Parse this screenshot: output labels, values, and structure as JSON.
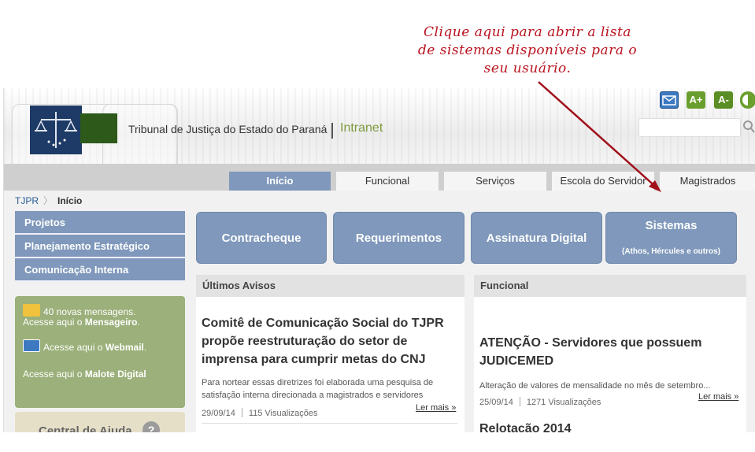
{
  "annotation": {
    "lines": [
      "Clique aqui para abrir a lista",
      "de sistemas disponíveis para o",
      "seu usuário."
    ],
    "color": "#b8121e"
  },
  "header": {
    "site_title": "Tribunal de Justiça do Estado do Paraná",
    "intranet": "Intranet",
    "tools": {
      "aplus": "A+",
      "aminus": "A-"
    }
  },
  "nav": {
    "tabs": [
      "Início",
      "Funcional",
      "Serviços",
      "Escola do Servidor",
      "Magistrados"
    ],
    "active": "Início"
  },
  "breadcrumb": {
    "home": "TJPR",
    "current": "Início"
  },
  "left_menu": [
    "Projetos",
    "Planejamento Estratégico",
    "Comunicação Interna"
  ],
  "messages": {
    "count_text": "40 novas mensagens.",
    "access_prefix": "Acesse aqui o",
    "mensageiro": "Mensageiro",
    "webmail": "Webmail",
    "malote_prefix": "Acesse aqui o",
    "malote": "Malote Digital"
  },
  "help": {
    "title": "Central de Ajuda",
    "icon": "?"
  },
  "quick_buttons": [
    {
      "label": "Contracheque"
    },
    {
      "label": "Requerimentos"
    },
    {
      "label": "Assinatura Digital"
    },
    {
      "label": "Sistemas",
      "sub": "(Athos, Hércules e outros)"
    }
  ],
  "avisos": {
    "heading": "Últimos Avisos",
    "title_lines": [
      "Comitê de Comunicação Social do TJPR",
      "propõe reestruturação do setor de",
      "imprensa para cumprir metas do CNJ"
    ],
    "desc_lines": [
      "Para nortear essas diretrizes foi elaborada uma pesquisa de",
      "satisfação interna direcionada a magistrados e servidores"
    ],
    "date": "29/09/14",
    "views": "115 Visualizações",
    "more": "Ler mais »"
  },
  "funcional": {
    "heading": "Funcional",
    "title_lines": [
      "ATENÇÃO - Servidores que possuem",
      "JUDICEMED"
    ],
    "desc": "Alteração de valores de mensalidade no mês de setembro...",
    "date": "25/09/14",
    "views": "1271 Visualizações",
    "more": "Ler mais »",
    "next_title": "Relotação 2014"
  }
}
